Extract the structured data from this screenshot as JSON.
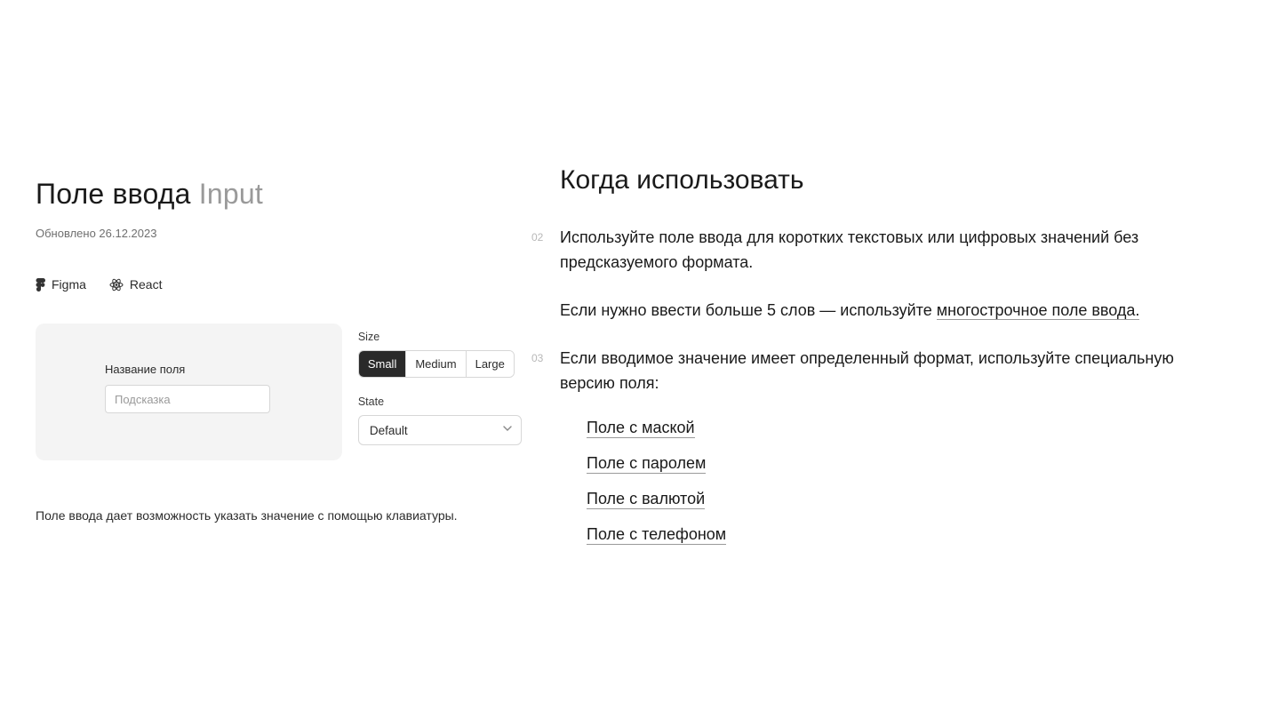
{
  "left": {
    "title_main": "Поле ввода",
    "title_sub": "Input",
    "updated": "Обновлено 26.12.2023",
    "links": {
      "figma": "Figma",
      "react": "React"
    },
    "demo": {
      "label": "Название поля",
      "placeholder": "Подсказка"
    },
    "controls": {
      "size_label": "Size",
      "sizes": {
        "small": "Small",
        "medium": "Medium",
        "large": "Large"
      },
      "state_label": "State",
      "state_value": "Default"
    },
    "lead": "Поле ввода дает возможность указать значение с помощью клавиатуры."
  },
  "right": {
    "section_title": "Когда использовать",
    "num_02": "02",
    "para_02a": "Используйте поле ввода для коротких текстовых или цифровых значений без предсказуемого формата.",
    "para_02b_prefix": "Если нужно ввести больше 5 слов — используйте ",
    "para_02b_link": "многострочное поле ввода.",
    "num_03": "03",
    "para_03": "Если вводимое значение имеет определенный формат, используйте специальную версию поля:",
    "spec_links": {
      "mask": "Поле с маской",
      "password": "Поле с паролем",
      "currency": "Поле с валютой",
      "phone": "Поле с телефоном"
    }
  }
}
